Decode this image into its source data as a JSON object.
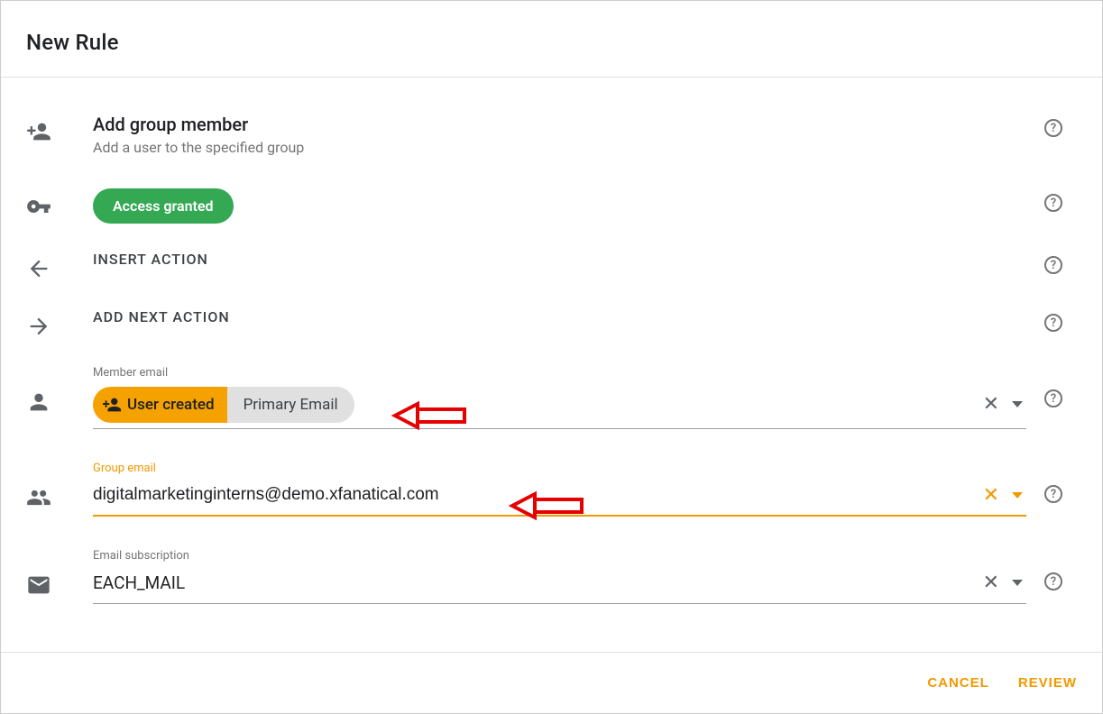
{
  "header": {
    "title": "New Rule"
  },
  "action": {
    "title": "Add group member",
    "subtitle": "Add a user to the specified group"
  },
  "access_badge": "Access granted",
  "insert_action_label": "INSERT ACTION",
  "add_next_action_label": "ADD NEXT ACTION",
  "member_email": {
    "label": "Member email",
    "chip_primary": "User created",
    "chip_secondary": "Primary Email"
  },
  "group_email": {
    "label": "Group email",
    "value": "digitalmarketinginterns@demo.xfanatical.com"
  },
  "email_subscription": {
    "label": "Email subscription",
    "value": "EACH_MAIL"
  },
  "footer": {
    "cancel": "CANCEL",
    "review": "REVIEW"
  }
}
